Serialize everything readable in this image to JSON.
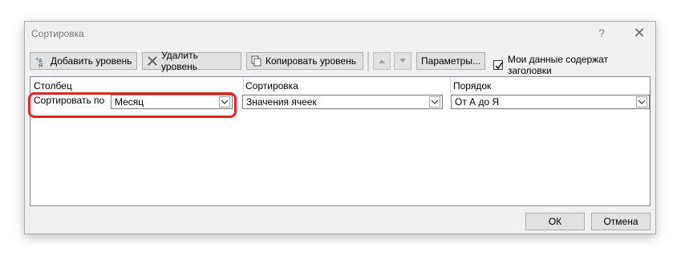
{
  "window": {
    "title": "Сортировка",
    "help_glyph": "?",
    "close_glyph": "✕"
  },
  "toolbar": {
    "add_level": "Добавить уровень",
    "delete_level": "Удалить уровень",
    "copy_level": "Копировать уровень",
    "options": "Параметры...",
    "headers_checkbox_label": "Мои данные содержат заголовки",
    "headers_checked": true
  },
  "grid": {
    "headers": {
      "column": "Столбец",
      "sort_on": "Сортировка",
      "order": "Порядок"
    },
    "row": {
      "label": "Сортировать по",
      "column_value": "Месяц",
      "sort_on_value": "Значения ячеек",
      "order_value": "От А до Я"
    }
  },
  "footer": {
    "ok": "ОК",
    "cancel": "Отмена"
  },
  "colors": {
    "highlight": "#e02424",
    "dialog_bg": "#f0f0f0",
    "title_text": "#777777"
  }
}
